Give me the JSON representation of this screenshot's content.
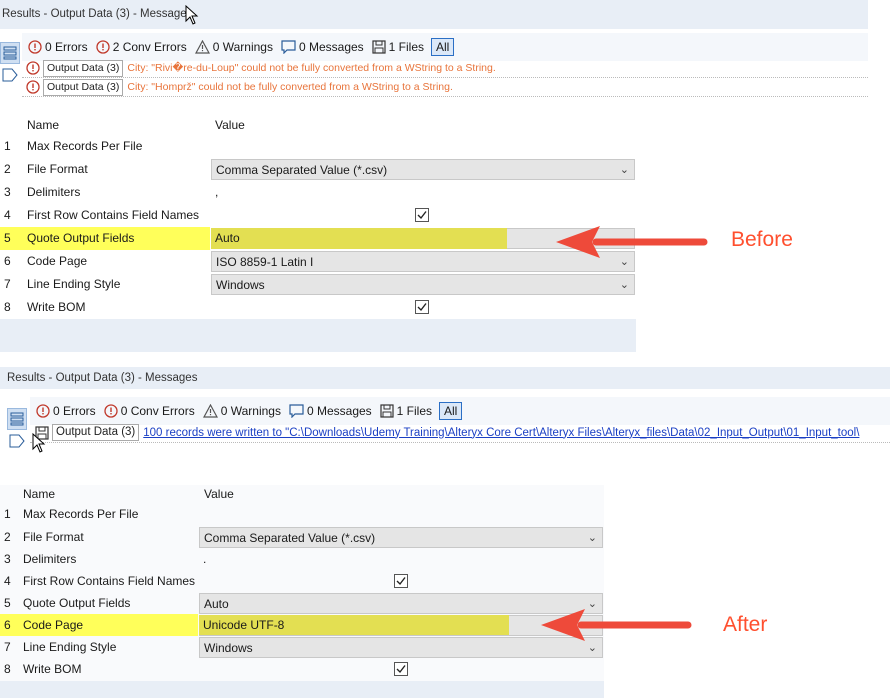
{
  "before": {
    "title": "Results - Output Data (3) - Messages",
    "toolbar": {
      "errors": "0 Errors",
      "conv_errors": "2 Conv Errors",
      "warnings": "0 Warnings",
      "messages": "0 Messages",
      "files": "1 Files",
      "all": "All"
    },
    "messages": [
      {
        "tool": "Output Data (3)",
        "text": "City: \"Rivi�re-du-Loup\" could not be fully converted from a WString to a String."
      },
      {
        "tool": "Output Data (3)",
        "text": "City: \"Homprž\" could not be fully converted from a WString to a String."
      }
    ],
    "grid": {
      "header_name": "Name",
      "header_value": "Value",
      "rows": [
        {
          "num": "1",
          "name": "Max Records Per File",
          "value": ""
        },
        {
          "num": "2",
          "name": "File Format",
          "value": "Comma Separated Value (*.csv)"
        },
        {
          "num": "3",
          "name": "Delimiters",
          "value": ","
        },
        {
          "num": "4",
          "name": "First Row Contains Field Names",
          "value": ""
        },
        {
          "num": "5",
          "name": "Quote Output Fields",
          "value": "Auto"
        },
        {
          "num": "6",
          "name": "Code Page",
          "value": "ISO 8859-1 Latin I"
        },
        {
          "num": "7",
          "name": "Line Ending Style",
          "value": "Windows"
        },
        {
          "num": "8",
          "name": "Write BOM",
          "value": ""
        }
      ]
    },
    "annotation": "Before"
  },
  "after": {
    "title": "Results - Output Data (3) - Messages",
    "toolbar": {
      "errors": "0 Errors",
      "conv_errors": "0 Conv Errors",
      "warnings": "0 Warnings",
      "messages": "0 Messages",
      "files": "1 Files",
      "all": "All"
    },
    "messages": [
      {
        "tool": "Output Data (3)",
        "text": "100 records were written to \"C:\\Downloads\\Udemy Training\\Alteryx Core Cert\\Alteryx Files\\Alteryx_files\\Data\\02_Input_Output\\01_Input_tool\\"
      }
    ],
    "grid": {
      "header_name": "Name",
      "header_value": "Value",
      "rows": [
        {
          "num": "1",
          "name": "Max Records Per File",
          "value": ""
        },
        {
          "num": "2",
          "name": "File Format",
          "value": "Comma Separated Value (*.csv)"
        },
        {
          "num": "3",
          "name": "Delimiters",
          "value": "."
        },
        {
          "num": "4",
          "name": "First Row Contains Field Names",
          "value": ""
        },
        {
          "num": "5",
          "name": "Quote Output Fields",
          "value": "Auto"
        },
        {
          "num": "6",
          "name": "Code Page",
          "value": "Unicode UTF-8"
        },
        {
          "num": "7",
          "name": "Line Ending Style",
          "value": "Windows"
        },
        {
          "num": "8",
          "name": "Write BOM",
          "value": ""
        }
      ]
    },
    "annotation": "After"
  },
  "colors": {
    "highlight": "#ffff5a",
    "highlight_value": "#e3df52",
    "arrow": "#ee4a3a",
    "warning_text": "#e8743b",
    "link": "#1a3fc4"
  }
}
